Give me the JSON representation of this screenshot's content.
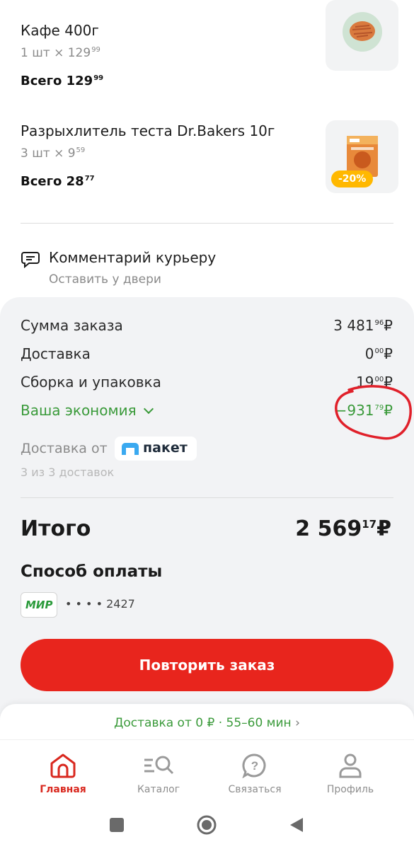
{
  "products": [
    {
      "name": "Кафе 400г",
      "qty": "1 шт × 129",
      "qty_kop": "99",
      "total": "Всего 129",
      "total_kop": "99",
      "badge": ""
    },
    {
      "name": "Разрыхлитель теста Dr.Bakers 10г",
      "qty": "3 шт × 9",
      "qty_kop": "59",
      "total": "Всего 28",
      "total_kop": "77",
      "badge": "-20%"
    }
  ],
  "comment": {
    "title": "Комментарий курьеру",
    "subtitle": "Оставить у двери"
  },
  "summary": {
    "order_label": "Сумма заказа",
    "order_value": "3 481",
    "order_kop": "96",
    "delivery_label": "Доставка",
    "delivery_value": "0",
    "delivery_kop": "00",
    "packing_label": "Сборка и упаковка",
    "packing_value": "19",
    "packing_kop": "00",
    "savings_label": "Ваша экономия",
    "savings_value": "−931",
    "savings_kop": "79",
    "currency": "₽"
  },
  "delivery_partner": {
    "label": "Доставка от",
    "brand": "пакет",
    "count": "3 из 3 доставок"
  },
  "total": {
    "label": "Итого",
    "value": "2 569",
    "kop": "17",
    "currency": "₽"
  },
  "payment": {
    "title": "Способ оплаты",
    "card_brand": "МИР",
    "card_mask": "• • • • 2427"
  },
  "repeat_button": "Повторить заказ",
  "promo": "Доставка от 0 ₽ · 55–60 мин",
  "tabs": [
    {
      "label": "Главная",
      "icon": "home-icon",
      "active": true
    },
    {
      "label": "Каталог",
      "icon": "catalog-search-icon",
      "active": false
    },
    {
      "label": "Связаться",
      "icon": "help-icon",
      "active": false
    },
    {
      "label": "Профиль",
      "icon": "profile-icon",
      "active": false
    }
  ],
  "colors": {
    "accent": "#e8251d",
    "green": "#3a9a3a",
    "badge": "#ffb800"
  }
}
